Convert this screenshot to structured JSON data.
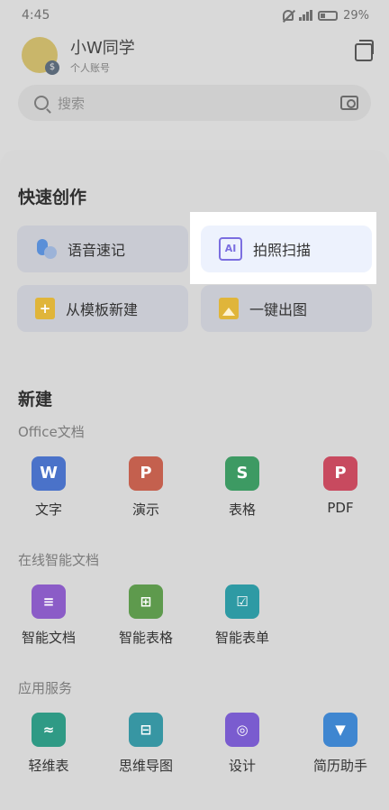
{
  "status": {
    "time": "4:45",
    "battery": "29%"
  },
  "account": {
    "name": "小W同学",
    "type": "个人账号"
  },
  "search": {
    "placeholder": "搜索"
  },
  "quick": {
    "title": "快速创作",
    "items": [
      {
        "label": "语音速记",
        "icon": "microphone-icon"
      },
      {
        "label": "拍照扫描",
        "icon": "ai-scan-icon",
        "highlighted": true
      },
      {
        "label": "从模板新建",
        "icon": "template-icon"
      },
      {
        "label": "一键出图",
        "icon": "image-icon"
      }
    ]
  },
  "create": {
    "title": "新建",
    "office": {
      "title": "Office文档",
      "apps": [
        {
          "label": "文字",
          "letter": "W",
          "color": "#4a72c9"
        },
        {
          "label": "演示",
          "letter": "P",
          "color": "#c4604e"
        },
        {
          "label": "表格",
          "letter": "S",
          "color": "#3d9a63"
        },
        {
          "label": "PDF",
          "letter": "P",
          "color": "#c84a5f"
        }
      ]
    },
    "smart": {
      "title": "在线智能文档",
      "apps": [
        {
          "label": "智能文档",
          "icon": "smart-doc-icon"
        },
        {
          "label": "智能表格",
          "icon": "smart-sheet-icon"
        },
        {
          "label": "智能表单",
          "icon": "smart-form-icon"
        }
      ]
    },
    "services": {
      "title": "应用服务",
      "apps": [
        {
          "label": "轻维表",
          "icon": "light-table-icon"
        },
        {
          "label": "思维导图",
          "icon": "mindmap-icon"
        },
        {
          "label": "设计",
          "icon": "design-icon"
        },
        {
          "label": "简历助手",
          "icon": "resume-icon"
        }
      ]
    }
  }
}
